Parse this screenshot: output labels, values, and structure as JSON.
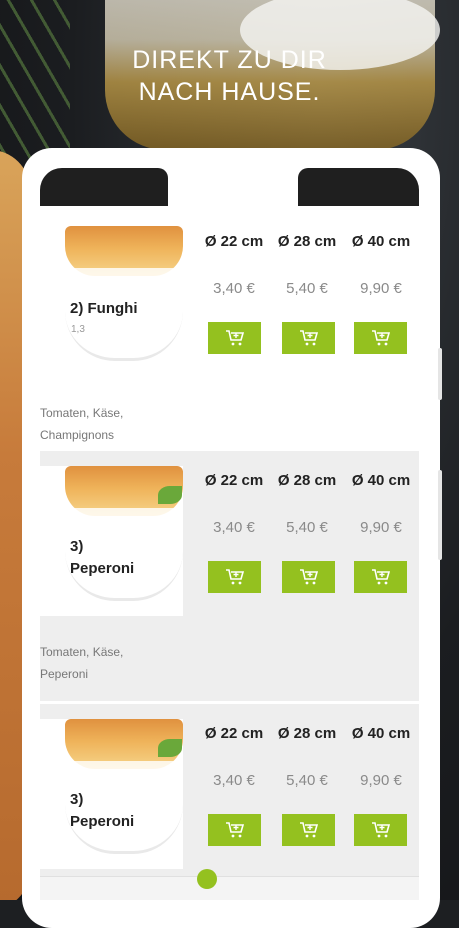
{
  "header": {
    "line1": "DIREKT ZU DIR",
    "line2": "NACH HAUSE."
  },
  "sizes": [
    "Ø 22 cm",
    "Ø 28 cm",
    "Ø 40 cm"
  ],
  "accent_color": "#94c11f",
  "cart_icon": "cart-plus-icon",
  "products": [
    {
      "name_line1": "2) Funghi",
      "name_line2": "",
      "note": "1,3",
      "prices": [
        "3,40 €",
        "5,40 €",
        "9,90 €"
      ],
      "desc_line1": "Tomaten, Käse,",
      "desc_line2": "Champignons"
    },
    {
      "name_line1": "3)",
      "name_line2": "Peperoni",
      "note": "",
      "prices": [
        "3,40 €",
        "5,40 €",
        "9,90 €"
      ],
      "desc_line1": "Tomaten, Käse,",
      "desc_line2": "Peperoni"
    },
    {
      "name_line1": "3)",
      "name_line2": "Peperoni",
      "note": "",
      "prices": [
        "3,40 €",
        "5,40 €",
        "9,90 €"
      ],
      "desc_line1": "",
      "desc_line2": ""
    }
  ]
}
